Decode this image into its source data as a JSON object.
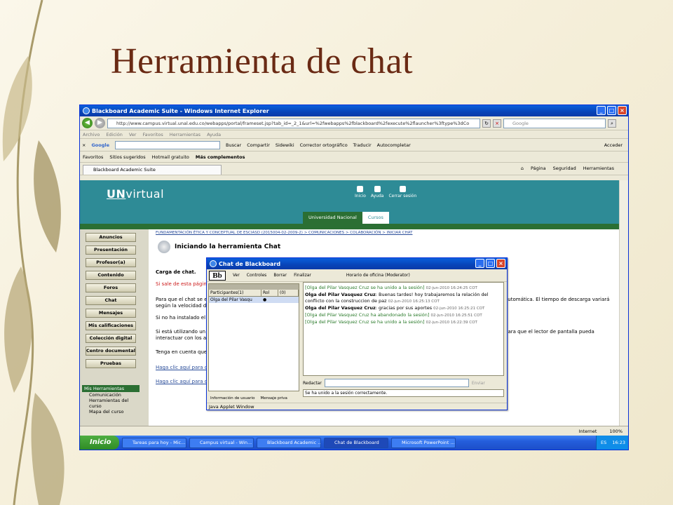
{
  "slide": {
    "title": "Herramienta de chat"
  },
  "browser": {
    "title": "Blackboard Academic Suite - Windows Internet Explorer",
    "address": "http://www.campus.virtual.unal.edu.co/webapps/portal/frameset.jsp?tab_id=_2_1&url=%2fwebapps%2fblackboard%2fexecute%2flauncher%3ftype%3dCo",
    "search_placeholder": "Google",
    "menu": [
      "Archivo",
      "Edición",
      "Ver",
      "Favoritos",
      "Herramientas",
      "Ayuda"
    ],
    "gtoolbar": {
      "google": "Google",
      "items": [
        "Buscar",
        "Compartir",
        "Sidewiki",
        "Corrector ortográfico",
        "Traducir",
        "Autocompletar"
      ],
      "acceder": "Acceder"
    },
    "favorites": [
      "Favoritos",
      "Sitios sugeridos",
      "Hotmail gratuito",
      "Más complementos"
    ],
    "tab": "Blackboard Academic Suite",
    "tab_tools": [
      "Página",
      "Seguridad",
      "Herramientas"
    ]
  },
  "site": {
    "logo_prefix": "UN",
    "logo_suffix": "virtual",
    "header_links": [
      "Inicio",
      "Ayuda",
      "Cerrar sesión"
    ],
    "tabs": [
      "Universidad Nacional",
      "Cursos"
    ],
    "nav": [
      "Anuncios",
      "Presentación",
      "Profesor(a)",
      "Contenido",
      "Foros",
      "Chat",
      "Mensajes",
      "Mis calificaciones",
      "Colección digital",
      "Centro documental",
      "Pruebas"
    ],
    "mis_herramientas": {
      "title": "Mis Herramientas",
      "items": [
        "Comunicación",
        "Herramientas del curso",
        "Mapa del curso"
      ]
    },
    "breadcrumb": "FUNDAMENTACIÓN ÉTICA Y CONCEPTUAL DE ESCIASD (2015004-02-2009-2) > COMUNICACIONES > COLABORACIÓN > INICIAR CHAT",
    "page_title": "Iniciando la herramienta Chat",
    "lines": {
      "carga": "Carga de chat.",
      "si_sale": "Si sale de esta págin",
      "para_que": "Para que el chat se e",
      "para_que_r": "automática. El tiempo de descarga variará",
      "segun": "según la velocidad de",
      "si_no": "Si no ha instalado el",
      "si_esta": "Si está utilizando un",
      "si_esta_r": "para que el lector de pantalla pueda",
      "interactuar": "interactuar con los a",
      "tenga": "Tenga en cuenta que",
      "link1": "Haga clic aquí para c",
      "link2": "Haga clic aquí para d"
    }
  },
  "chat": {
    "title": "Chat de Blackboard",
    "toolbar": [
      "Ver",
      "Controles",
      "Borrar",
      "Finalizar"
    ],
    "session": "Horario de oficina (Moderator)",
    "participants_header": [
      "Participantes(1)",
      "Rol",
      "(0)"
    ],
    "participant": "Olga del Pilar Vasqu",
    "messages": [
      {
        "who": "[Olga del Pilar Vasquez Cruz",
        "text": " se ha unido a la sesión]",
        "ts": "02-jun-2010 16:24:25 COT",
        "system": true
      },
      {
        "who": "Olga del Pilar Vasquez Cruz",
        "text": ": Buenas tardes! hoy trabajaremos la relación del",
        "ts": "",
        "system": false
      },
      {
        "who": "",
        "text": "conflicto con la construccion de paz",
        "ts": "02-jun-2010 16:25:13 COT",
        "system": false
      },
      {
        "who": "Olga del Pilar Vasquez Cruz",
        "text": ": gracias por sus aportes",
        "ts": "02-jun-2010 16:25:21 COT",
        "system": false
      },
      {
        "who": "[Olga del Pilar Vasquez Cruz",
        "text": " ha abandonado la sesión]",
        "ts": "02-jun-2010 16:25:51 COT",
        "system": true
      },
      {
        "who": "[Olga del Pilar Vasquez Cruz",
        "text": " se ha unido a la sesión]",
        "ts": "02-jun-2010 16:22:39 COT",
        "system": true
      }
    ],
    "compose_label": "Redactar",
    "send_label": "Enviar",
    "status": "Se ha unido a la sesión correctamente.",
    "info_usuario": "Información de usuario",
    "mensaje_priv": "Mensaje priva",
    "applet": "Java Applet Window"
  },
  "statusbar": {
    "zone": "Internet",
    "zoom": "100%"
  },
  "taskbar": {
    "start": "Inicio",
    "tasks": [
      "Tareas para hoy - Mic...",
      "Campus virtual - Win...",
      "Blackboard Academic ...",
      "Chat de Blackboard",
      "Microsoft PowerPoint ..."
    ],
    "lang": "ES",
    "time": "16:23"
  }
}
